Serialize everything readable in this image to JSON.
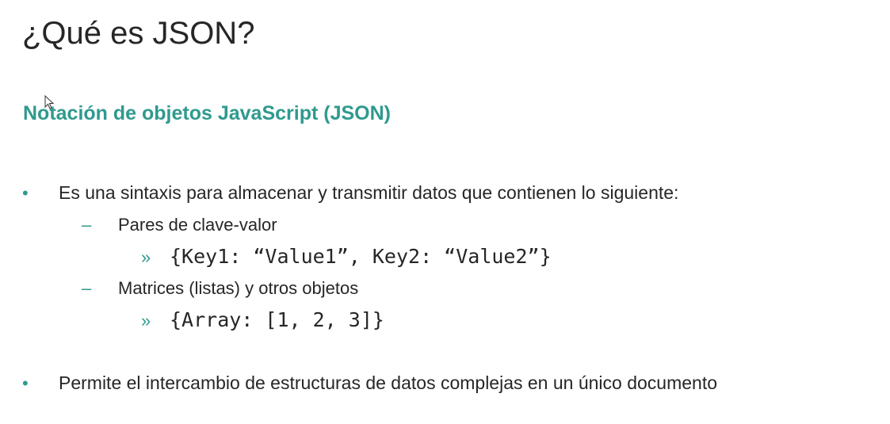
{
  "slide": {
    "title": "¿Qué es JSON?",
    "subtitle": "Notación de objetos JavaScript (JSON)",
    "bullets": [
      {
        "marker": "•",
        "text": "Es una sintaxis para almacenar y transmitir datos que contienen lo siguiente:",
        "children": [
          {
            "marker": "–",
            "text": "Pares de clave-valor",
            "example_marker": "»",
            "example": "{Key1: “Value1”, Key2: “Value2”}"
          },
          {
            "marker": "–",
            "text": "Matrices (listas) y otros objetos",
            "example_marker": "»",
            "example": "{Array: [1, 2, 3]}"
          }
        ]
      },
      {
        "marker": "•",
        "text": "Permite el intercambio de estructuras de datos complejas en un único documento"
      }
    ],
    "accent_color": "#2f9a8e",
    "text_color": "#262626",
    "cursor_icon": "mouse-pointer-icon"
  }
}
